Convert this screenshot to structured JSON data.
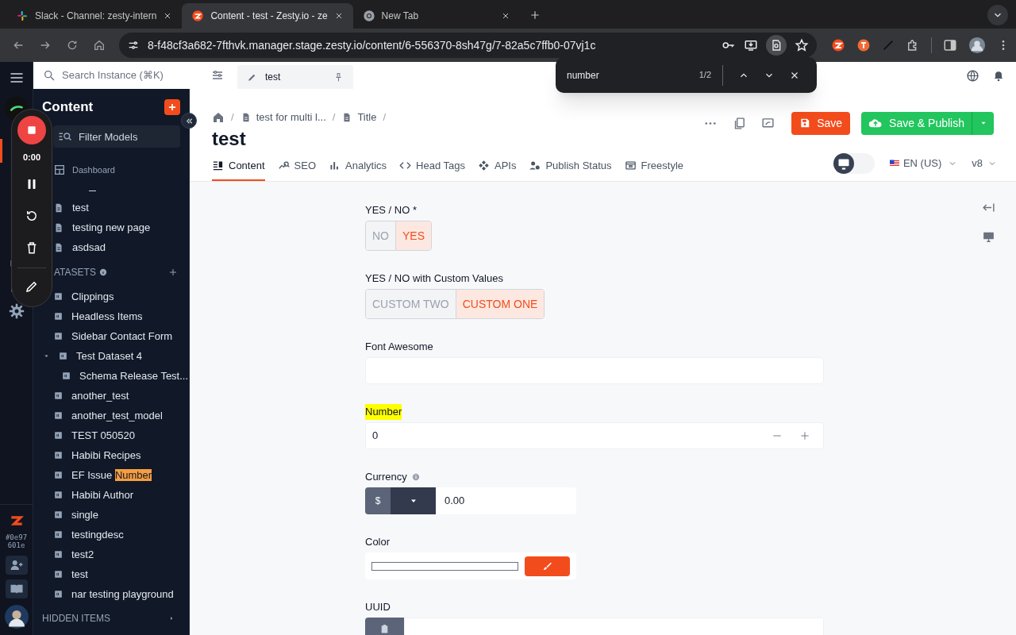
{
  "browser": {
    "tabs": [
      {
        "title": "Slack - Channel: zesty-intern",
        "selected": false
      },
      {
        "title": "Content - test - Zesty.io - ze",
        "selected": true
      },
      {
        "title": "New Tab",
        "selected": false
      }
    ],
    "url": "8-f48cf3a682-7fthvk.manager.stage.zesty.io/content/6-556370-8sh47g/7-82a5c7ffb0-07vj1c"
  },
  "find_bar": {
    "query": "number",
    "count": "1/2"
  },
  "topbar": {
    "search_placeholder": "Search Instance (⌘K)",
    "open_tab": "test"
  },
  "rail": {
    "build_hash": [
      "#0e97",
      "601e"
    ]
  },
  "recorder": {
    "time": "0:00"
  },
  "sidebar": {
    "title": "Content",
    "filter_placeholder": "Filter Models",
    "dashboard": "Dashboard",
    "pages": [
      {
        "label": "test"
      },
      {
        "label": "testing new page"
      },
      {
        "label": "asdsad"
      }
    ],
    "datasets_heading": "ATASETS",
    "datasets": [
      {
        "label": "Clippings"
      },
      {
        "label": "Headless Items"
      },
      {
        "label": "Sidebar Contact Form"
      },
      {
        "label": "Test Dataset 4",
        "expanded": true,
        "children": [
          {
            "label": "Schema Release Test..."
          }
        ]
      },
      {
        "label": "another_test"
      },
      {
        "label": "another_test_model"
      },
      {
        "label": "TEST 050520"
      },
      {
        "label": "Habibi Recipes"
      },
      {
        "label": "EF Issue",
        "match": "Number"
      },
      {
        "label": "Habibi Author"
      },
      {
        "label": "single"
      },
      {
        "label": "testingdesc"
      },
      {
        "label": "test2"
      },
      {
        "label": "test"
      },
      {
        "label": "nar testing playground"
      }
    ],
    "hidden_items": "HIDDEN ITEMS"
  },
  "breadcrumb": [
    {
      "kind": "home",
      "separator": "/"
    },
    {
      "kind": "page",
      "label": "test for multi l...",
      "separator": "/"
    },
    {
      "kind": "page",
      "label": "Title",
      "separator": "/"
    }
  ],
  "title": "test",
  "actions": {
    "save": "Save",
    "publish": "Save & Publish"
  },
  "tabs": [
    {
      "label": "Content",
      "selected": true
    },
    {
      "label": "SEO",
      "selected": false
    },
    {
      "label": "Analytics",
      "selected": false
    },
    {
      "label": "Head Tags",
      "selected": false
    },
    {
      "label": "APIs",
      "selected": false
    },
    {
      "label": "Publish Status",
      "selected": false
    },
    {
      "label": "Freestyle",
      "selected": false
    }
  ],
  "device_preview": {
    "on": false
  },
  "locale": "EN (US)",
  "version": "v8",
  "fields": [
    {
      "kind": "toggle",
      "label": "YES / NO *",
      "options": [
        {
          "label": "NO",
          "selected": false
        },
        {
          "label": "YES",
          "selected": true
        }
      ]
    },
    {
      "kind": "toggle",
      "label": "YES / NO with Custom Values",
      "options": [
        {
          "label": "CUSTOM TWO",
          "selected": false
        },
        {
          "label": "CUSTOM ONE",
          "selected": true
        }
      ]
    },
    {
      "kind": "text",
      "label": "Font Awesome"
    },
    {
      "kind": "number",
      "label": "Number",
      "highlighted": true,
      "value": "0"
    },
    {
      "kind": "currency",
      "label": "Currency",
      "info": true,
      "symbol": "$",
      "value": "0.00"
    },
    {
      "kind": "color",
      "label": "Color"
    },
    {
      "kind": "uuid",
      "label": "UUID"
    }
  ]
}
